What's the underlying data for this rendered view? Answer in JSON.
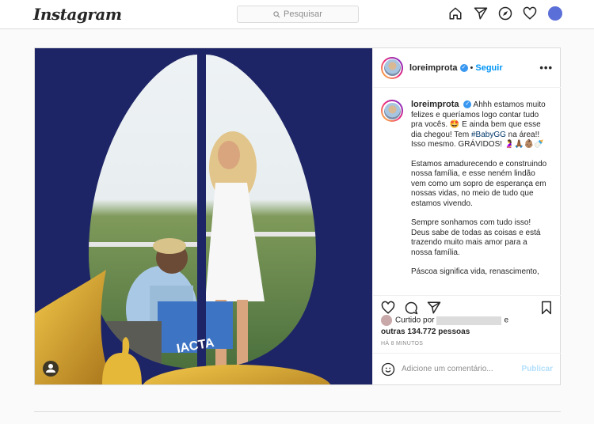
{
  "header": {
    "logo": "Instagram",
    "search_placeholder": "Pesquisar"
  },
  "post": {
    "username": "loreimprota",
    "follow_label": "Seguir",
    "more_label": "•••",
    "caption": {
      "username": "loreimprota",
      "paragraph1_a": "Ahhh estamos muito felizes e queríamos logo contar tudo pra vocês. 🤩 E ainda bem que esse dia chegou! Tem ",
      "hashtag": "#BabyGG",
      "paragraph1_b": " na área!! Isso mesmo. GRÁVIDOS! 🤰🙏🏾👶🏽🍼",
      "paragraph2": "Estamos amadurecendo e construindo nossa família, e esse neném lindão vem como um sopro de esperança em nossas vidas, no meio de tudo que estamos vivendo.",
      "paragraph3": "Sempre sonhamos com tudo isso! Deus sabe de todas as coisas e está trazendo muito mais amor para a nossa família.",
      "paragraph4": "Páscoa significa vida, renascimento,"
    },
    "likes": {
      "prefix": "Curtido por",
      "conjunction": "e",
      "others": "outras 134.772 pessoas"
    },
    "time": "HÁ 8 MINUTOS",
    "comment_placeholder": "Adicione um comentário...",
    "publish_label": "Publicar",
    "image_text": "IACTA"
  },
  "colors": {
    "accent": "#0095f6",
    "image_bg": "#1e2566",
    "gold": "#d9a824"
  }
}
